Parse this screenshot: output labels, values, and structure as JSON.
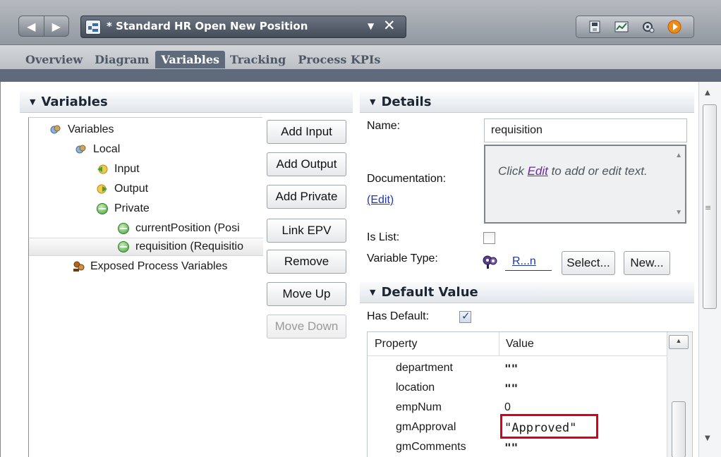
{
  "window": {
    "process_title": "* Standard HR Open New Position",
    "dropdown_arrow": "▼",
    "close_glyph": "✕",
    "toolbar_icons": [
      "save-icon",
      "chart-icon",
      "gear-icon",
      "run-icon"
    ]
  },
  "tabs": [
    {
      "label": "Overview",
      "active": false
    },
    {
      "label": "Diagram",
      "active": false
    },
    {
      "label": "Variables",
      "active": true
    },
    {
      "label": "Tracking",
      "active": false
    },
    {
      "label": "Process KPIs",
      "active": false
    }
  ],
  "variables_panel": {
    "title": "Variables",
    "tree": [
      {
        "label": "Variables"
      },
      {
        "label": "Local"
      },
      {
        "label": "Input"
      },
      {
        "label": "Output"
      },
      {
        "label": "Private"
      },
      {
        "label": "currentPosition (Posi"
      },
      {
        "label": "requisition (Requisitio",
        "selected": true
      },
      {
        "label": "Exposed Process Variables"
      }
    ],
    "buttons": {
      "add_input": "Add Input",
      "add_output": "Add Output",
      "add_private": "Add Private",
      "link_epv": "Link EPV",
      "remove": "Remove",
      "move_up": "Move Up",
      "move_down": "Move Down"
    }
  },
  "details_panel": {
    "title": "Details",
    "name_label": "Name:",
    "name_value": "requisition",
    "documentation_label": "Documentation:",
    "documentation_edit_link": "(Edit)",
    "doc_text_before": "Click ",
    "doc_text_link": "Edit",
    "doc_text_after": " to add or edit text.",
    "is_list_label": "Is List:",
    "is_list_checked": false,
    "variable_type_label": "Variable Type:",
    "variable_type_value": "R...n",
    "select_button": "Select...",
    "new_button": "New..."
  },
  "default_value_panel": {
    "title": "Default Value",
    "has_default_label": "Has Default:",
    "has_default_checked": true,
    "columns": [
      "Property",
      "Value"
    ],
    "rows": [
      {
        "property": "department",
        "value": "\"\""
      },
      {
        "property": "location",
        "value": "\"\""
      },
      {
        "property": "empNum",
        "value": "0"
      },
      {
        "property": "gmApproval",
        "value": "\"Approved\""
      },
      {
        "property": "gmComments",
        "value": "\"\""
      }
    ]
  },
  "colors": {
    "accent": "#5f6b7a",
    "highlight_box": "#d9001b",
    "link": "#2036b0"
  }
}
